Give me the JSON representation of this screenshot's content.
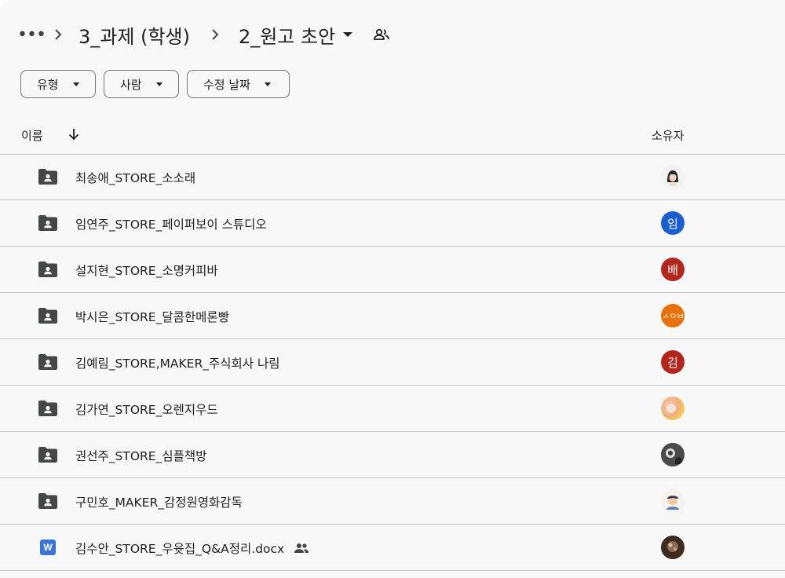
{
  "breadcrumb": {
    "more_label": "•••",
    "parent": "3_과제 (학생)",
    "current": "2_원고 초안"
  },
  "filters": [
    {
      "label": "유형"
    },
    {
      "label": "사람"
    },
    {
      "label": "수정 날짜"
    }
  ],
  "table": {
    "col_name": "이름",
    "col_owner": "소유자",
    "sort_icon": "arrow-down-icon"
  },
  "rows": [
    {
      "name": "최송애_STORE_소소래",
      "type": "shared-folder",
      "owner_avatar": {
        "kind": "photo",
        "color": "#2a2a2a",
        "text": ""
      }
    },
    {
      "name": "임연주_STORE_페이퍼보이 스튜디오",
      "type": "shared-folder",
      "owner_avatar": {
        "kind": "initial",
        "color": "#1a5fd0",
        "text": "임"
      }
    },
    {
      "name": "설지현_STORE_소명커피바",
      "type": "shared-folder",
      "owner_avatar": {
        "kind": "initial",
        "color": "#b3261e",
        "text": "배"
      }
    },
    {
      "name": "박시은_STORE_달콤한메론빵",
      "type": "shared-folder",
      "owner_avatar": {
        "kind": "initial",
        "color": "#e8710a",
        "text": "ㅅㅇㅂ"
      }
    },
    {
      "name": "김예림_STORE,MAKER_주식회사 나림",
      "type": "shared-folder",
      "owner_avatar": {
        "kind": "initial",
        "color": "#b3261e",
        "text": "김"
      }
    },
    {
      "name": "김가연_STORE_오렌지우드",
      "type": "shared-folder",
      "owner_avatar": {
        "kind": "photo",
        "color": "#f2c27a",
        "text": ""
      }
    },
    {
      "name": "권선주_STORE_심플책방",
      "type": "shared-folder",
      "owner_avatar": {
        "kind": "photo",
        "color": "#555555",
        "text": ""
      }
    },
    {
      "name": "구민호_MAKER_감정원영화감독",
      "type": "shared-folder",
      "owner_avatar": {
        "kind": "photo",
        "color": "#d9c8a8",
        "text": ""
      }
    },
    {
      "name": "김수안_STORE_우윳집_Q&A정리.docx",
      "type": "word-doc",
      "icon_letter": "W",
      "shared": true,
      "owner_avatar": {
        "kind": "photo",
        "color": "#6b4a36",
        "text": ""
      }
    }
  ]
}
